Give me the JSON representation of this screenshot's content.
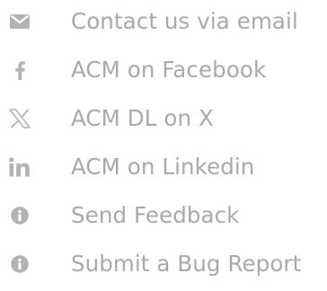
{
  "icon_color": "#b3b3b3",
  "text_color": "#a9a9a9",
  "links": [
    {
      "icon": "envelope-icon",
      "label": "Contact us via email"
    },
    {
      "icon": "facebook-icon",
      "label": "ACM on Facebook"
    },
    {
      "icon": "x-logo-icon",
      "label": "ACM DL on X"
    },
    {
      "icon": "linkedin-icon",
      "label": "ACM on Linkedin"
    },
    {
      "icon": "info-circle-icon",
      "label": "Send Feedback"
    },
    {
      "icon": "info-circle-icon",
      "label": "Submit a Bug Report"
    }
  ]
}
